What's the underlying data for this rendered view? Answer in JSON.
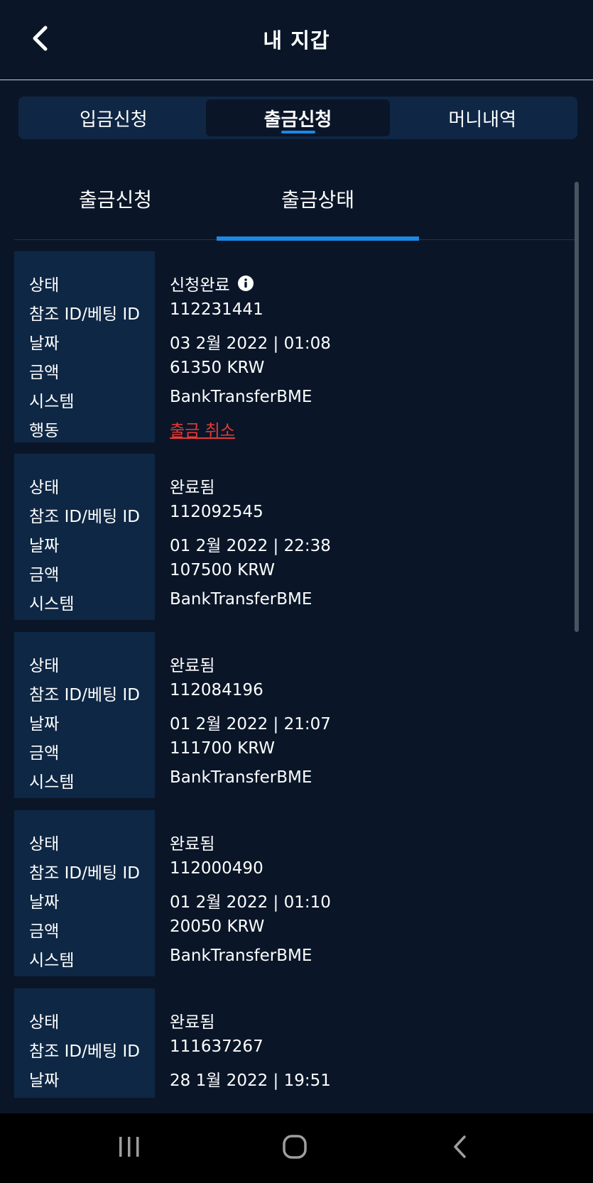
{
  "header": {
    "title": "내 지갑",
    "back_icon": "chevron-left-icon"
  },
  "top_tabs": [
    {
      "label": "입금신청",
      "active": false
    },
    {
      "label": "출금신청",
      "active": true
    },
    {
      "label": "머니내역",
      "active": false
    }
  ],
  "sub_tabs": [
    {
      "label": "출금신청",
      "active": false
    },
    {
      "label": "출금상태",
      "active": true
    }
  ],
  "field_labels": {
    "status": "상태",
    "ref_id": "참조 ID/베팅 ID",
    "date": "날짜",
    "amount": "금액",
    "system": "시스템",
    "action": "행동"
  },
  "records": [
    {
      "status": "신청완료",
      "ref_id": "112231441",
      "date": "03 2월 2022 | 01:08",
      "amount": "61350 KRW",
      "system": "BankTransferBME",
      "action": "출금 취소"
    },
    {
      "status": "완료됨",
      "ref_id": "112092545",
      "date": "01 2월 2022 | 22:38",
      "amount": "107500 KRW",
      "system": "BankTransferBME"
    },
    {
      "status": "완료됨",
      "ref_id": "112084196",
      "date": "01 2월 2022 | 21:07",
      "amount": "111700 KRW",
      "system": "BankTransferBME"
    },
    {
      "status": "완료됨",
      "ref_id": "112000490",
      "date": "01 2월 2022 | 01:10",
      "amount": "20050 KRW",
      "system": "BankTransferBME"
    },
    {
      "status": "완료됨",
      "ref_id": "111637267",
      "date": "28 1월 2022 | 19:51"
    }
  ],
  "colors": {
    "background": "#0a1628",
    "label_panel": "#0e2744",
    "accent": "#1e88e5",
    "cancel_link": "#e53935"
  }
}
